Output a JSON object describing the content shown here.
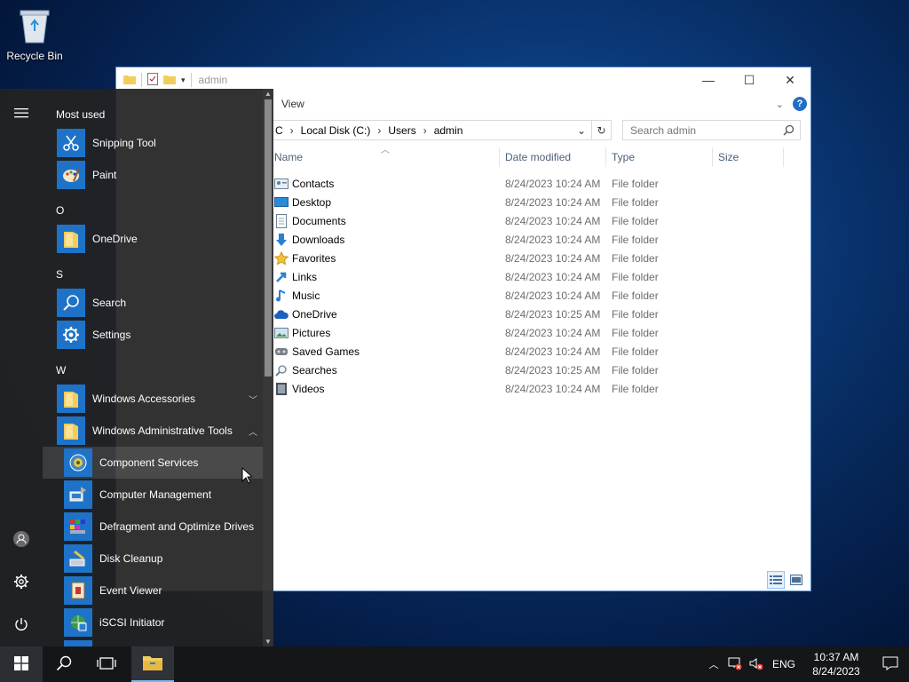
{
  "desktop": {
    "recycle_bin_label": "Recycle Bin"
  },
  "explorer": {
    "title": "admin",
    "ribbon_view_tab": "View",
    "address_segments": [
      "C",
      "Local Disk (C:)",
      "Users",
      "admin"
    ],
    "search_placeholder": "Search admin",
    "columns": {
      "name": "Name",
      "date": "Date modified",
      "type": "Type",
      "size": "Size"
    },
    "rows": [
      {
        "name": "Contacts",
        "date": "8/24/2023 10:24 AM",
        "type": "File folder",
        "icon": "contacts-icon"
      },
      {
        "name": "Desktop",
        "date": "8/24/2023 10:24 AM",
        "type": "File folder",
        "icon": "desktop-icon"
      },
      {
        "name": "Documents",
        "date": "8/24/2023 10:24 AM",
        "type": "File folder",
        "icon": "documents-icon"
      },
      {
        "name": "Downloads",
        "date": "8/24/2023 10:24 AM",
        "type": "File folder",
        "icon": "downloads-icon"
      },
      {
        "name": "Favorites",
        "date": "8/24/2023 10:24 AM",
        "type": "File folder",
        "icon": "favorites-icon"
      },
      {
        "name": "Links",
        "date": "8/24/2023 10:24 AM",
        "type": "File folder",
        "icon": "links-icon"
      },
      {
        "name": "Music",
        "date": "8/24/2023 10:24 AM",
        "type": "File folder",
        "icon": "music-icon"
      },
      {
        "name": "OneDrive",
        "date": "8/24/2023 10:25 AM",
        "type": "File folder",
        "icon": "onedrive-icon"
      },
      {
        "name": "Pictures",
        "date": "8/24/2023 10:24 AM",
        "type": "File folder",
        "icon": "pictures-icon"
      },
      {
        "name": "Saved Games",
        "date": "8/24/2023 10:24 AM",
        "type": "File folder",
        "icon": "saved-games-icon"
      },
      {
        "name": "Searches",
        "date": "8/24/2023 10:25 AM",
        "type": "File folder",
        "icon": "searches-icon"
      },
      {
        "name": "Videos",
        "date": "8/24/2023 10:24 AM",
        "type": "File folder",
        "icon": "videos-icon"
      }
    ]
  },
  "start_menu": {
    "most_used_header": "Most used",
    "most_used": [
      {
        "label": "Snipping Tool",
        "icon": "snipping-tool-icon"
      },
      {
        "label": "Paint",
        "icon": "paint-icon"
      }
    ],
    "section_o": "O",
    "onedrive": "OneDrive",
    "section_s": "S",
    "search": "Search",
    "settings": "Settings",
    "section_w": "W",
    "windows_accessories": "Windows Accessories",
    "windows_admin_tools": "Windows Administrative Tools",
    "admin_tools": [
      {
        "label": "Component Services",
        "icon": "component-services-icon"
      },
      {
        "label": "Computer Management",
        "icon": "computer-management-icon"
      },
      {
        "label": "Defragment and Optimize Drives",
        "icon": "defragment-icon"
      },
      {
        "label": "Disk Cleanup",
        "icon": "disk-cleanup-icon"
      },
      {
        "label": "Event Viewer",
        "icon": "event-viewer-icon"
      },
      {
        "label": "iSCSI Initiator",
        "icon": "iscsi-initiator-icon"
      }
    ]
  },
  "taskbar": {
    "language": "ENG",
    "time": "10:37 AM",
    "date": "8/24/2023"
  },
  "colors": {
    "accent": "#1e73c8",
    "start_bg": "#222224",
    "taskbar_bg": "#141618"
  }
}
